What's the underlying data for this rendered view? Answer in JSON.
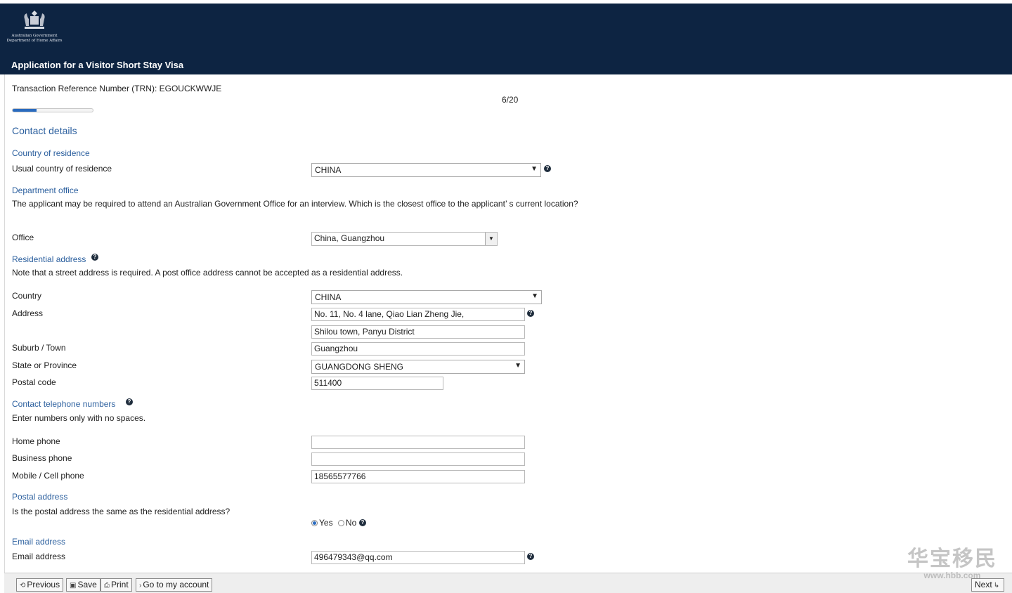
{
  "header": {
    "gov_line1": "Australian Government",
    "gov_line2": "Department of Home Affairs",
    "app_title": "Application for a Visitor Short Stay Visa"
  },
  "trn": "Transaction Reference Number (TRN): EGOUCKWWJE",
  "progress": {
    "label": "6/20",
    "current": 6,
    "total": 20
  },
  "page_heading": "Contact details",
  "country_of_residence": {
    "section": "Country of residence",
    "label": "Usual country of residence",
    "value": "CHINA"
  },
  "department_office": {
    "section": "Department office",
    "note": "The applicant may be required to attend an Australian Government Office for an interview. Which is the closest office to the applicant’ s current location?",
    "label": "Office",
    "value": "China, Guangzhou"
  },
  "residential_address": {
    "section": "Residential address",
    "note": "Note that a street address is required. A post office address cannot be accepted as a residential address.",
    "country_label": "Country",
    "country_value": "CHINA",
    "address_label": "Address",
    "address_line1": "No. 11, No. 4 lane, Qiao Lian Zheng Jie,",
    "address_line2": "Shilou town, Panyu District",
    "suburb_label": "Suburb / Town",
    "suburb_value": "Guangzhou",
    "state_label": "State or Province",
    "state_value": "GUANGDONG SHENG",
    "postal_label": "Postal code",
    "postal_value": "511400"
  },
  "contact_phone": {
    "section": "Contact telephone numbers",
    "note": "Enter numbers only with no spaces.",
    "home_label": "Home phone",
    "home_value": "",
    "business_label": "Business phone",
    "business_value": "",
    "mobile_label": "Mobile / Cell phone",
    "mobile_value": "18565577766"
  },
  "postal_address": {
    "section": "Postal address",
    "question": "Is the postal address the same as the residential address?",
    "yes_label": "Yes",
    "no_label": "No",
    "selected": "Yes"
  },
  "email": {
    "section": "Email address",
    "label": "Email address",
    "value": "496479343@qq.com"
  },
  "footer": {
    "previous": "Previous",
    "save": "Save",
    "print": "Print",
    "go_to_account": "Go to my account",
    "next": "Next"
  },
  "icons": {
    "help": "question-circle-icon",
    "dropdown": "chevron-down-icon"
  },
  "colors": {
    "header_bg": "#0d2442",
    "link_blue": "#2b5f9e",
    "progress_fill": "#2a6bbf"
  },
  "watermark": {
    "cn": "华宝移民",
    "url": "www.hbb.com"
  }
}
